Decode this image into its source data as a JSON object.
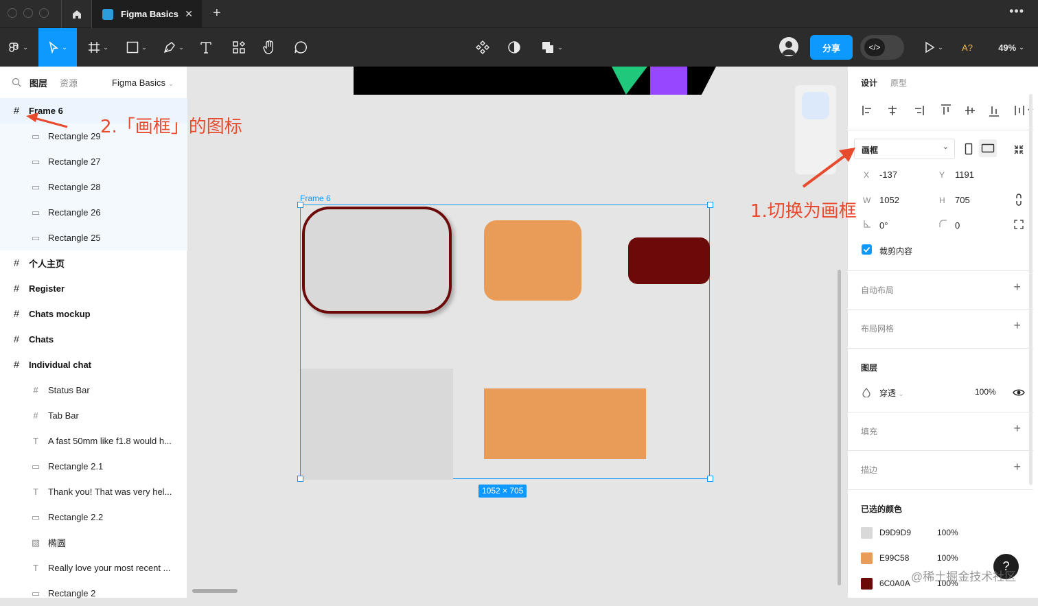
{
  "window": {
    "tab_title": "Figma Basics"
  },
  "toolbar": {
    "share": "分享",
    "sub": "A?",
    "zoom": "49%"
  },
  "left_panel": {
    "tabs": {
      "layers": "图层",
      "assets": "资源",
      "page": "Figma Basics"
    },
    "layers": [
      {
        "name": "Frame 6",
        "icon": "frame-icon",
        "level": 0
      },
      {
        "name": "Rectangle 29",
        "icon": "rectangle-icon",
        "level": 1
      },
      {
        "name": "Rectangle 27",
        "icon": "rectangle-icon",
        "level": 1
      },
      {
        "name": "Rectangle 28",
        "icon": "rectangle-icon",
        "level": 1
      },
      {
        "name": "Rectangle 26",
        "icon": "rectangle-icon",
        "level": 1
      },
      {
        "name": "Rectangle 25",
        "icon": "rectangle-icon",
        "level": 1
      },
      {
        "name": "个人主页",
        "icon": "frame-icon",
        "level": 0
      },
      {
        "name": "Register",
        "icon": "frame-icon",
        "level": 0
      },
      {
        "name": "Chats mockup",
        "icon": "frame-icon",
        "level": 0
      },
      {
        "name": "Chats",
        "icon": "frame-icon",
        "level": 0
      },
      {
        "name": "Individual chat",
        "icon": "frame-icon",
        "level": 0
      },
      {
        "name": "Status Bar",
        "icon": "frame-icon",
        "level": 1
      },
      {
        "name": "Tab Bar",
        "icon": "frame-icon",
        "level": 1
      },
      {
        "name": "A fast 50mm like f1.8 would h...",
        "icon": "text-icon",
        "level": 1
      },
      {
        "name": "Rectangle 2.1",
        "icon": "rectangle-icon",
        "level": 1
      },
      {
        "name": "Thank you! That was very hel...",
        "icon": "text-icon",
        "level": 1
      },
      {
        "name": "Rectangle 2.2",
        "icon": "rectangle-icon",
        "level": 1
      },
      {
        "name": "椭圆",
        "icon": "image-icon",
        "level": 1
      },
      {
        "name": "Really love your most recent ...",
        "icon": "text-icon",
        "level": 1
      },
      {
        "name": "Rectangle 2",
        "icon": "rectangle-icon",
        "level": 1
      }
    ]
  },
  "canvas": {
    "frame_label": "Frame 6",
    "size_badge": "1052 × 705",
    "annotation_1": "1.切换为画框",
    "annotation_2": "2.「画框」的图标",
    "colors": {
      "gray": "#D9D9D9",
      "orange": "#E99C58",
      "darkred": "#6C0A0A",
      "selection": "#0d99ff",
      "annotation": "#e84a2e"
    }
  },
  "right_panel": {
    "tabs": {
      "design": "设计",
      "prototype": "原型"
    },
    "frame_type": "画框",
    "x_label": "X",
    "x": "-137",
    "y_label": "Y",
    "y": "1191",
    "w_label": "W",
    "w": "1052",
    "h_label": "H",
    "h": "705",
    "rotation": "0°",
    "radius": "0",
    "clip_content": "裁剪内容",
    "auto_layout": "自动布局",
    "layout_grid": "布局网格",
    "layer": "图层",
    "blend_mode": "穿透",
    "opacity": "100%",
    "fill": "填充",
    "stroke": "描边",
    "selection_colors": "已选的颜色",
    "colors": [
      {
        "hex": "D9D9D9",
        "opacity": "100%",
        "swatch": "#D9D9D9"
      },
      {
        "hex": "E99C58",
        "opacity": "100%",
        "swatch": "#E99C58"
      },
      {
        "hex": "6C0A0A",
        "opacity": "100%",
        "swatch": "#6C0A0A"
      }
    ]
  },
  "watermark": "@稀土掘金技术社区",
  "help": "?"
}
